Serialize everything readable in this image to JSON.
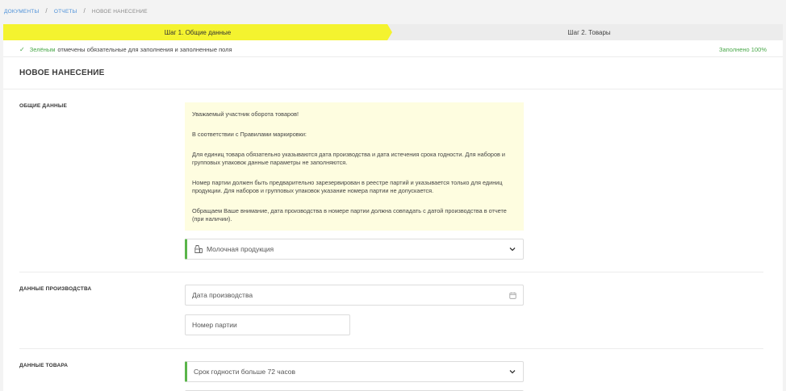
{
  "breadcrumb": {
    "items": [
      "ДОКУМЕНТЫ",
      "ОТЧЕТЫ"
    ],
    "separator": "/",
    "current": "НОВОЕ НАНЕСЕНИЕ"
  },
  "steps": [
    {
      "label": "Шаг 1. Общие данные",
      "active": true
    },
    {
      "label": "Шаг 2. Товары",
      "active": false
    }
  ],
  "notice": {
    "green_word": "Зелёным",
    "text": "отмечены обязательные для заполнения и заполненные поля",
    "filled": "Заполнено 100%"
  },
  "page_title": "НОВОЕ НАНЕСЕНИЕ",
  "sections": {
    "general": {
      "label": "ОБЩИЕ ДАННЫЕ",
      "info": [
        "Уважаемый участник оборота товаров!",
        "В соответствии с Правилами маркировки:",
        "Для единиц товара обязательно указываются дата производства и дата истечения срока годности. Для наборов и групповых упаковок данные параметры не заполняются.",
        "Номер партии должен быть предварительно зарезервирован в реестре партий и указывается только для единиц продукции. Для наборов и групповых упаковок указание номера партии не допускается.",
        "Обращаем Ваше внимание, дата производства в номере партии должна совпадать с датой производства в отчете (при наличии)."
      ],
      "product_group": "Молочная продукция"
    },
    "production": {
      "label": "ДАННЫЕ ПРОИЗВОДСТВА",
      "date_placeholder": "Дата производства",
      "batch_placeholder": "Номер партии"
    },
    "product": {
      "label": "ДАННЫЕ ТОВАРА",
      "shelf_life": "Срок годности больше 72 часов"
    }
  },
  "colors": {
    "accent_yellow": "#f4f32f",
    "valid_green": "#5ab54a",
    "link_blue": "#4a8fd8",
    "info_bg": "#fefde0"
  }
}
